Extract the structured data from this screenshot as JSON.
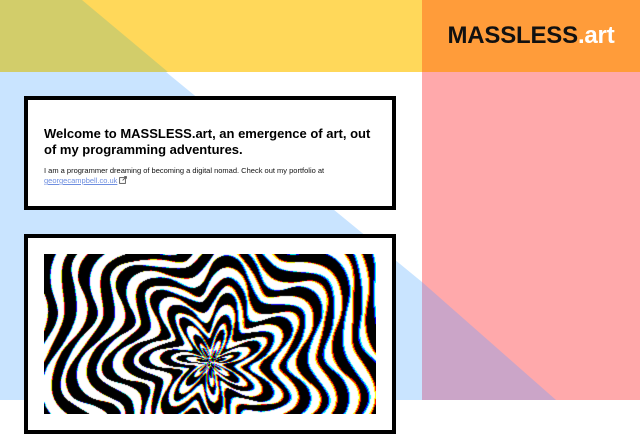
{
  "colors": {
    "yellow": "#ffd85a",
    "olive": "#d2cd6a",
    "orange": "#ff9c3a",
    "pink": "#ffa9ab",
    "blue": "#c9e4ff",
    "mauve": "#cba5c8",
    "link": "#6f8fe0"
  },
  "header": {
    "site_name": "MASSLESS",
    "site_tld": ".art"
  },
  "intro": {
    "heading": "Welcome to MASSLESS.art, an emergence of art, out of my programming adventures.",
    "text": "I am a programmer dreaming of becoming a digital nomad. Check out my portfolio at",
    "link_text": "georgecampbell.co.uk",
    "link_icon": "external-link-icon"
  },
  "artwork": {
    "icon": "generative-art-image"
  }
}
